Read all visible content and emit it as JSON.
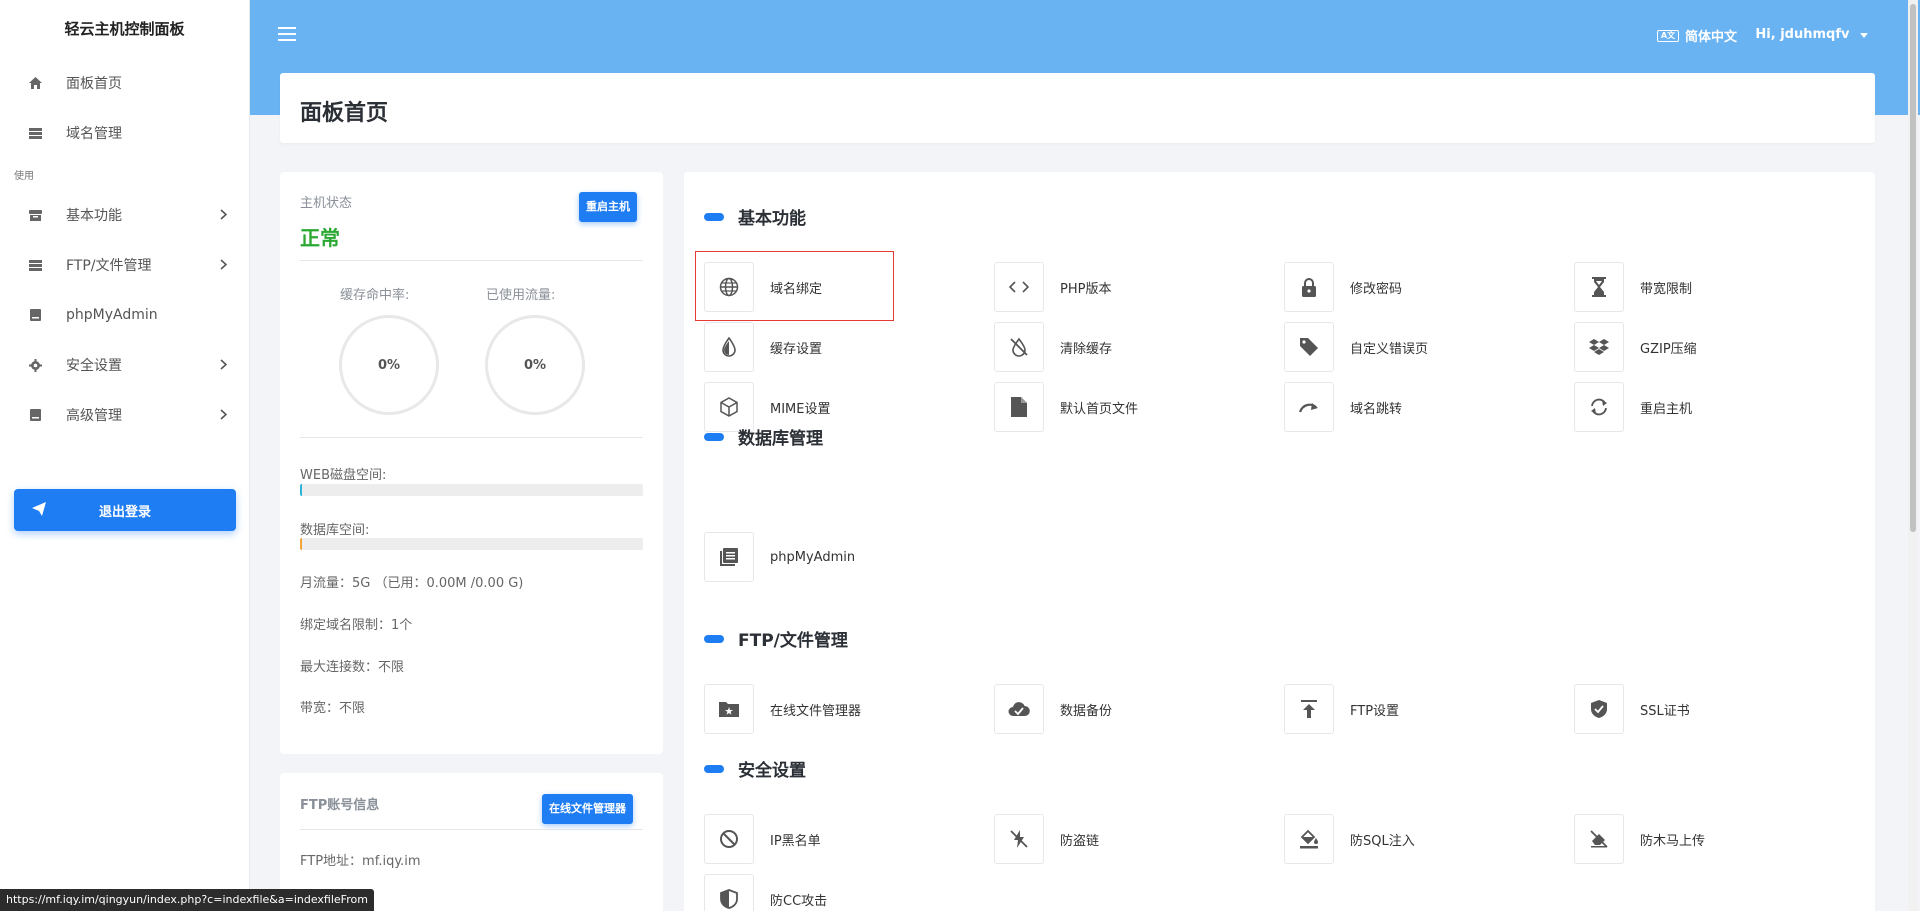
{
  "sidebar": {
    "brand": "轻云主机控制面板",
    "items": [
      {
        "label": "面板首页",
        "icon": "home-icon"
      },
      {
        "label": "域名管理",
        "icon": "server-icon"
      }
    ],
    "section": "使用",
    "items2": [
      {
        "label": "基本功能",
        "icon": "box-icon",
        "chevron": true
      },
      {
        "label": "FTP/文件管理",
        "icon": "server-icon",
        "chevron": true
      },
      {
        "label": "phpMyAdmin",
        "icon": "database-icon",
        "chevron": false
      },
      {
        "label": "安全设置",
        "icon": "gear-icon",
        "chevron": true
      },
      {
        "label": "高级管理",
        "icon": "database-icon",
        "chevron": true
      }
    ],
    "logout": "退出登录"
  },
  "header": {
    "language": "简体中文",
    "language_icon_text": "A文",
    "user": "Hi, jduhmqfv"
  },
  "page_title": "面板首页",
  "status": {
    "label": "主机状态",
    "restart_button": "重启主机",
    "state": "正常",
    "cache_hit_label": "缓存命中率:",
    "cache_hit_value": "0%",
    "traffic_used_label": "已使用流量:",
    "traffic_used_value": "0%",
    "web_disk_label": "WEB磁盘空间:",
    "web_disk_fraction": 0.005,
    "db_space_label": "数据库空间:",
    "db_space_fraction": 0.005,
    "monthly_traffic": "月流量：5G （已用：0.00M /0.00 G)",
    "domain_limit": "绑定域名限制：1个",
    "max_connections": "最大连接数：不限",
    "bandwidth": "带宽：不限"
  },
  "ftp": {
    "label": "FTP账号信息",
    "file_manager_button": "在线文件管理器",
    "address": "FTP地址：mf.iqy.im"
  },
  "sections": {
    "basic": {
      "title": "基本功能",
      "items": [
        {
          "label": "域名绑定",
          "icon": "globe-icon"
        },
        {
          "label": "PHP版本",
          "icon": "code-icon"
        },
        {
          "label": "修改密码",
          "icon": "lock-icon"
        },
        {
          "label": "带宽限制",
          "icon": "hourglass-icon"
        },
        {
          "label": "缓存设置",
          "icon": "drop-icon"
        },
        {
          "label": "清除缓存",
          "icon": "tint-slash-icon"
        },
        {
          "label": "自定义错误页",
          "icon": "tag-icon"
        },
        {
          "label": "GZIP压缩",
          "icon": "dropbox-icon"
        },
        {
          "label": "MIME设置",
          "icon": "cube-icon"
        },
        {
          "label": "默认首页文件",
          "icon": "file-icon"
        },
        {
          "label": "域名跳转",
          "icon": "redo-arrow-icon"
        },
        {
          "label": "重启主机",
          "icon": "sync-icon"
        }
      ]
    },
    "database": {
      "title": "数据库管理",
      "items": [
        {
          "label": "phpMyAdmin",
          "icon": "book-icon"
        }
      ]
    },
    "ftp": {
      "title": "FTP/文件管理",
      "items": [
        {
          "label": "在线文件管理器",
          "icon": "folder-star-icon"
        },
        {
          "label": "数据备份",
          "icon": "cloud-check-icon"
        },
        {
          "label": "FTP设置",
          "icon": "upload-icon"
        },
        {
          "label": "SSL证书",
          "icon": "shield-check-icon"
        }
      ]
    },
    "security": {
      "title": "安全设置",
      "items": [
        {
          "label": "IP黑名单",
          "icon": "ban-icon"
        },
        {
          "label": "防盗链",
          "icon": "bolt-slash-icon"
        },
        {
          "label": "防SQL注入",
          "icon": "fill-icon"
        },
        {
          "label": "防木马上传",
          "icon": "eraser-slash-icon"
        },
        {
          "label": "防CC攻击",
          "icon": "shield-half-icon"
        }
      ]
    }
  },
  "statusbar": "https://mf.iqy.im/qingyun/index.php?c=indexfile&a=indexfileFrom",
  "colors": {
    "accent": "#1e7df2",
    "header": "#6ab3f2",
    "ok": "#2aa832",
    "highlight": "#e53935"
  }
}
